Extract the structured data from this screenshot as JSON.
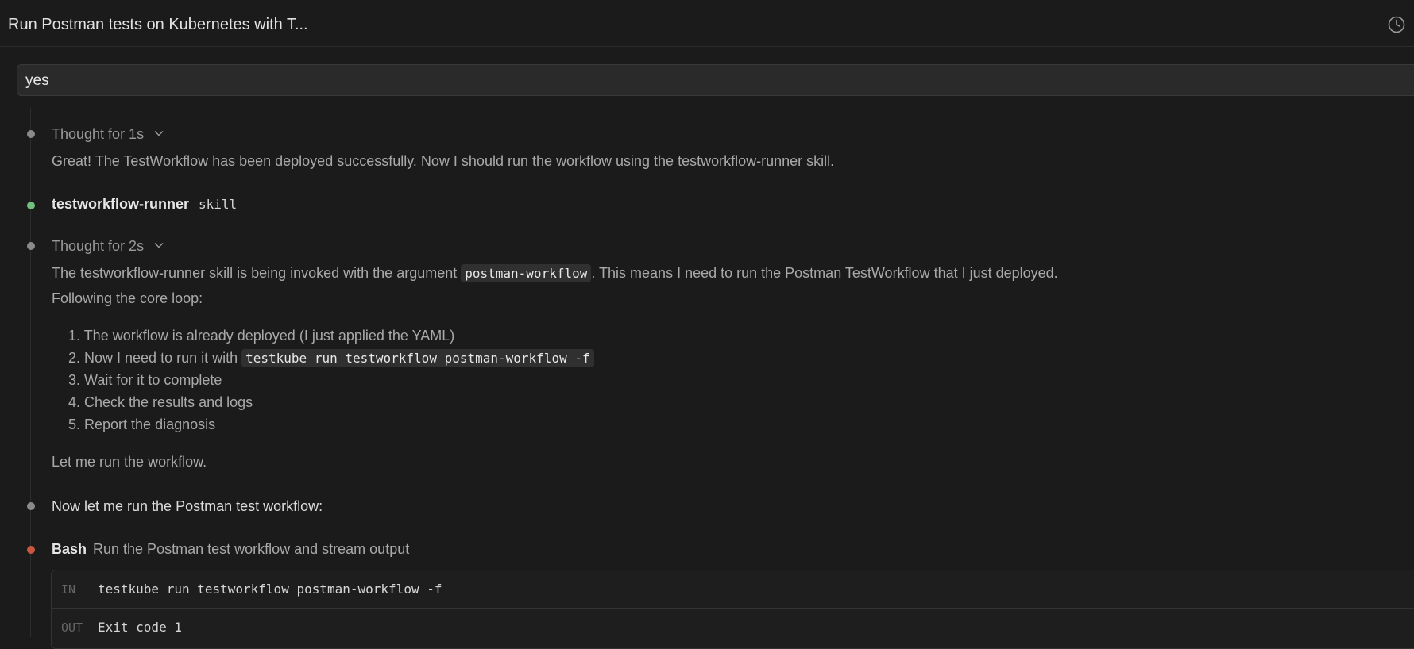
{
  "header": {
    "title": "Run Postman tests on Kubernetes with T...",
    "history_icon": "clock-history-icon"
  },
  "user_message": "yes",
  "thought1": {
    "label": "Thought for 1s",
    "text": "Great! The TestWorkflow has been deployed successfully. Now I should run the workflow using the testworkflow-runner skill."
  },
  "skill": {
    "name": "testworkflow-runner",
    "tag": "skill"
  },
  "thought2": {
    "label": "Thought for 2s",
    "line1_pre": "The testworkflow-runner skill is being invoked with the argument ",
    "line1_code": "postman-workflow",
    "line1_post": ". This means I need to run the Postman TestWorkflow that I just deployed.",
    "line2": "Following the core loop:",
    "steps": [
      {
        "num": "1.",
        "text": "The workflow is already deployed (I just applied the YAML)"
      },
      {
        "num": "2.",
        "text": "Now I need to run it with ",
        "code": "testkube run testworkflow postman-workflow -f"
      },
      {
        "num": "3.",
        "text": "Wait for it to complete"
      },
      {
        "num": "4.",
        "text": "Check the results and logs"
      },
      {
        "num": "5.",
        "text": "Report the diagnosis"
      }
    ],
    "closing": "Let me run the workflow."
  },
  "message": "Now let me run the Postman test workflow:",
  "bash": {
    "tool": "Bash",
    "description": "Run the Postman test workflow and stream output",
    "in_label": "IN",
    "command": "testkube run testworkflow postman-workflow -f",
    "out_label": "OUT",
    "output": "Exit code 1"
  },
  "colors": {
    "background": "#1b1b1b",
    "status_gray": "#8a8a8a",
    "status_green": "#6fbf7d",
    "status_red": "#c9573f"
  }
}
